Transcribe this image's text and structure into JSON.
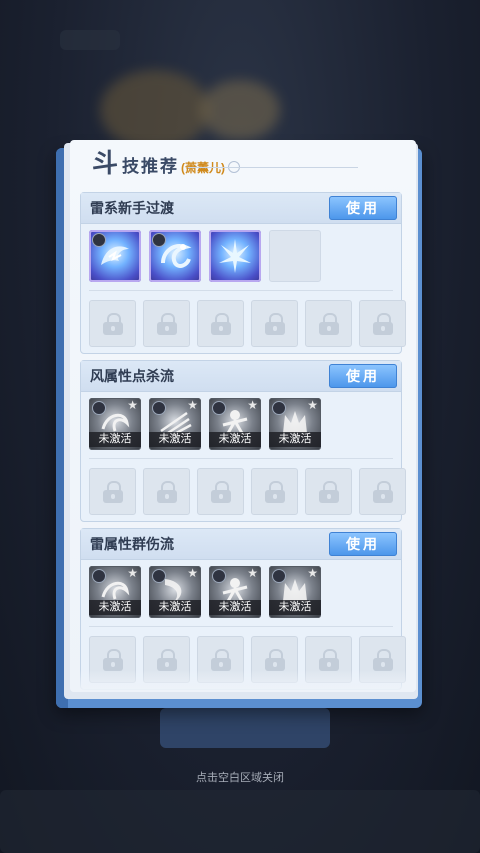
{
  "page_title": {
    "big": "斗",
    "rest": "技推荐",
    "character": "(萧薰儿)"
  },
  "builds": [
    {
      "name": "雷系新手过渡",
      "use_label": "使用",
      "skills": [
        {
          "state": "active",
          "icon": "lightning-dragon-icon"
        },
        {
          "state": "active",
          "icon": "lightning-serpent-icon"
        },
        {
          "state": "active",
          "icon": "lightning-burst-icon"
        },
        {
          "state": "empty",
          "icon": "empty-slot"
        }
      ],
      "locked_slots": 6
    },
    {
      "name": "风属性点杀流",
      "use_label": "使用",
      "skills": [
        {
          "state": "inactive",
          "label": "未激活",
          "icon": "wind-swirl-icon"
        },
        {
          "state": "inactive",
          "label": "未激活",
          "icon": "wind-slash-icon"
        },
        {
          "state": "inactive",
          "label": "未激活",
          "icon": "wind-warrior-icon"
        },
        {
          "state": "inactive",
          "label": "未激活",
          "icon": "wind-crown-icon"
        }
      ],
      "locked_slots": 6
    },
    {
      "name": "雷属性群伤流",
      "use_label": "使用",
      "skills": [
        {
          "state": "inactive",
          "label": "未激活",
          "icon": "thunder-swirl-icon"
        },
        {
          "state": "inactive",
          "label": "未激活",
          "icon": "thunder-slash-icon"
        },
        {
          "state": "inactive",
          "label": "未激活",
          "icon": "thunder-warrior-icon"
        },
        {
          "state": "inactive",
          "label": "未激活",
          "icon": "thunder-crown-icon"
        }
      ],
      "locked_slots": 6
    }
  ],
  "close_hint": "点击空白区域关闭",
  "colors": {
    "accent": "#4a95ea",
    "character": "#d08a1c",
    "title": "#3a4a66"
  }
}
